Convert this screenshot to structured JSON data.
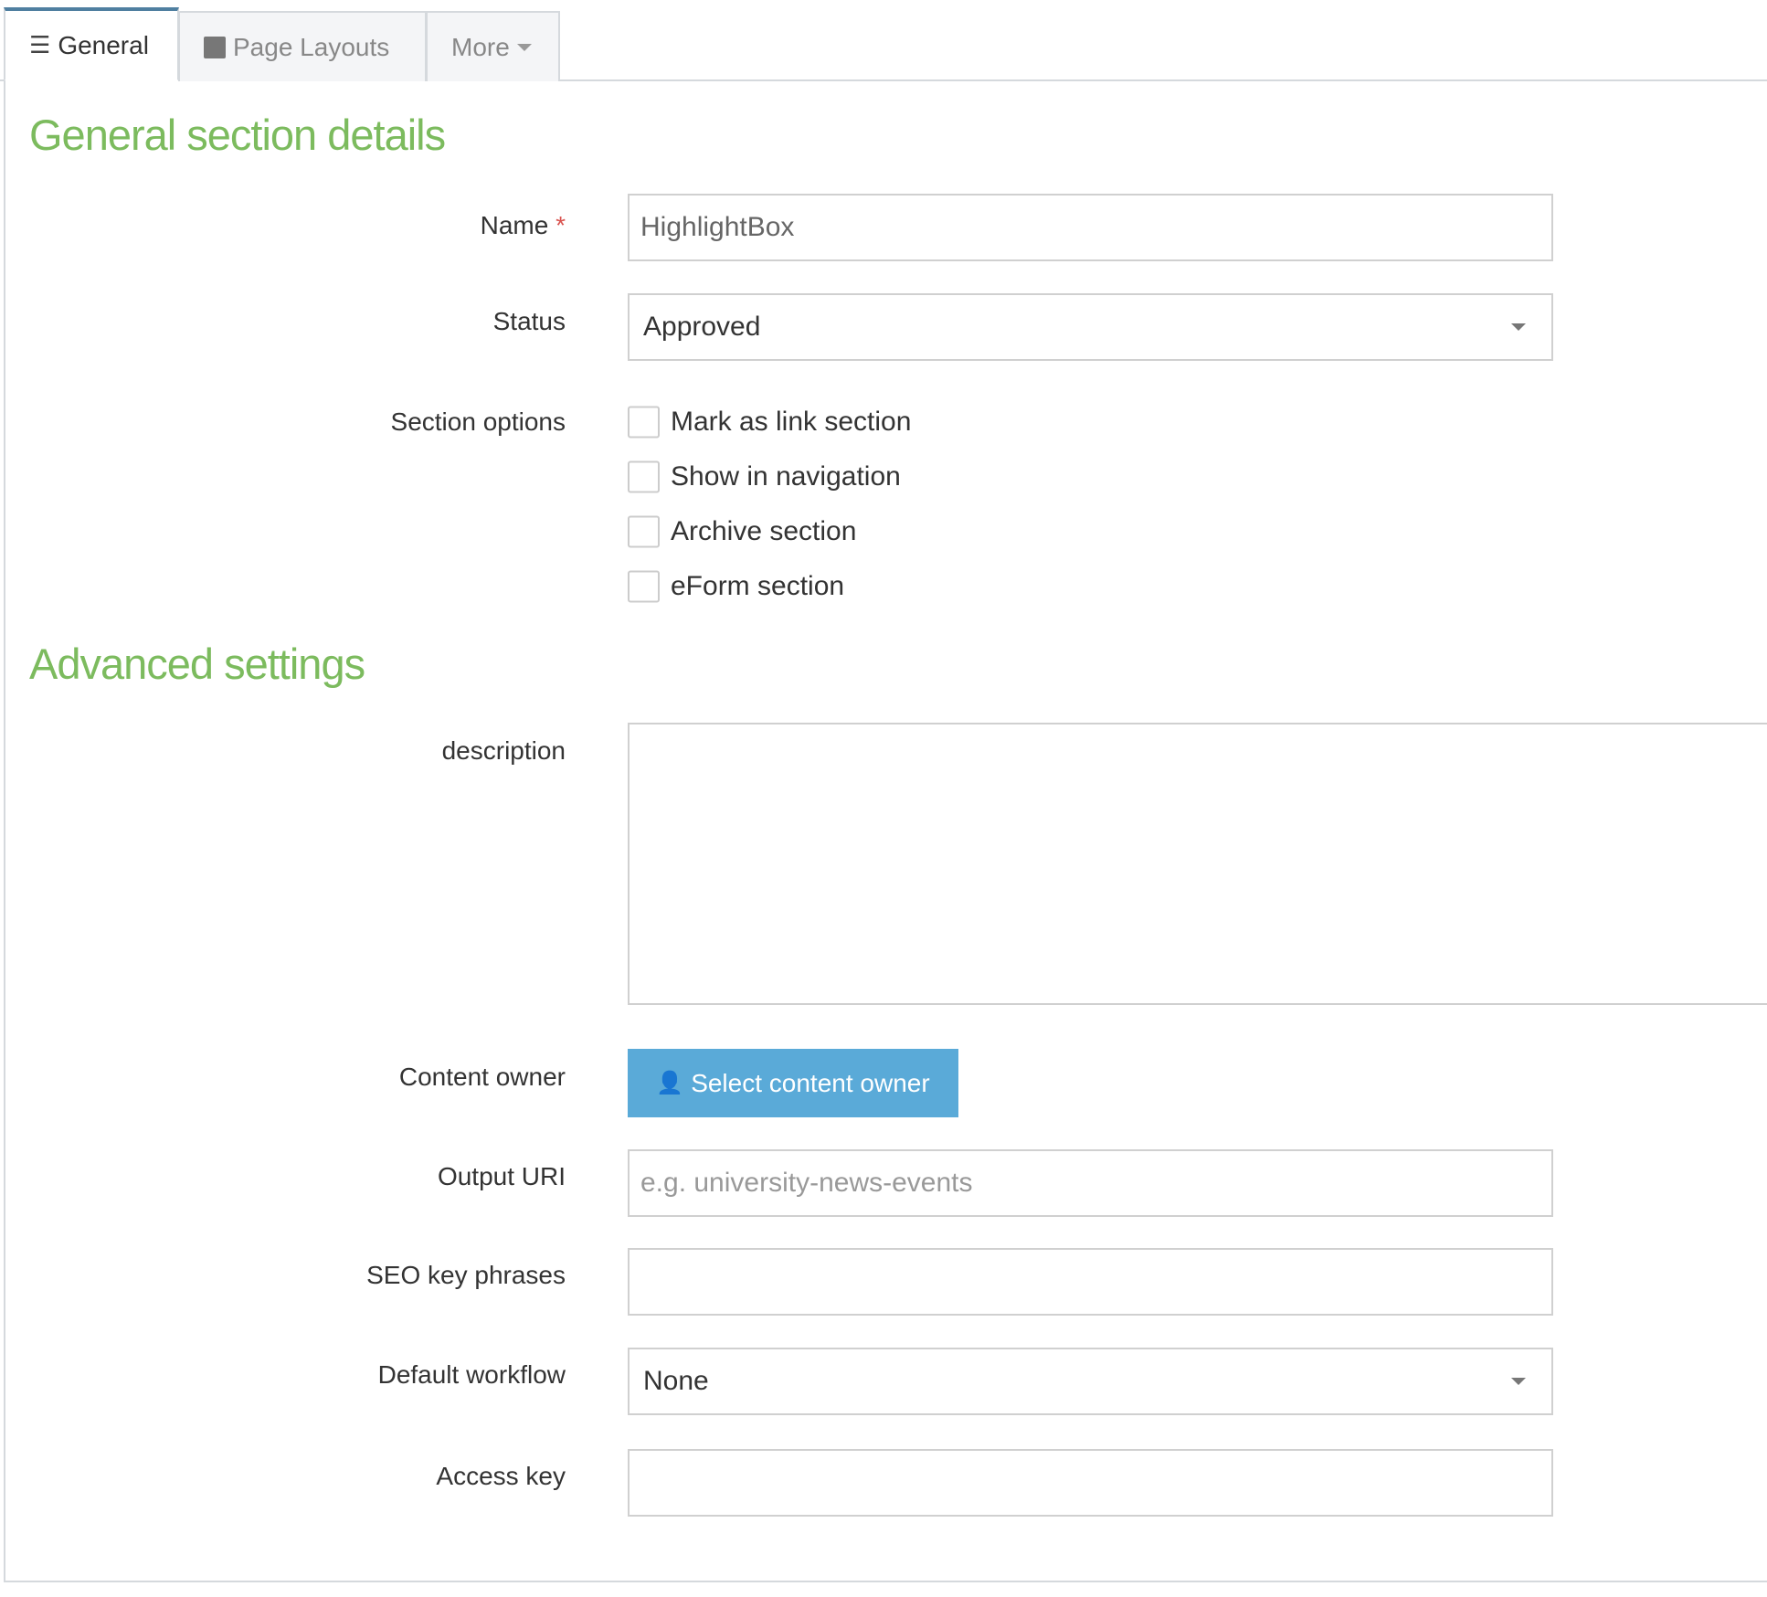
{
  "tabs": [
    {
      "label": "General",
      "icon": "sliders-icon"
    },
    {
      "label": "Page Layouts",
      "icon": "puzzle-icon"
    },
    {
      "label": "More",
      "icon": "caret-down-icon"
    }
  ],
  "general": {
    "heading": "General section details",
    "name_label": "Name",
    "required_mark": "*",
    "name_value": "HighlightBox",
    "status_label": "Status",
    "status_value": "Approved",
    "options_label": "Section options",
    "options": [
      "Mark as link section",
      "Show in navigation",
      "Archive section",
      "eForm section"
    ]
  },
  "advanced": {
    "heading": "Advanced settings",
    "description_label": "description",
    "content_owner_label": "Content owner",
    "content_owner_button": "Select content owner",
    "output_uri_label": "Output URI",
    "output_uri_placeholder": "e.g. university-news-events",
    "seo_label": "SEO key phrases",
    "workflow_label": "Default workflow",
    "workflow_value": "None",
    "access_key_label": "Access key"
  },
  "colors": {
    "accent_green": "#7cbb5e",
    "button_blue": "#5aaad8"
  }
}
